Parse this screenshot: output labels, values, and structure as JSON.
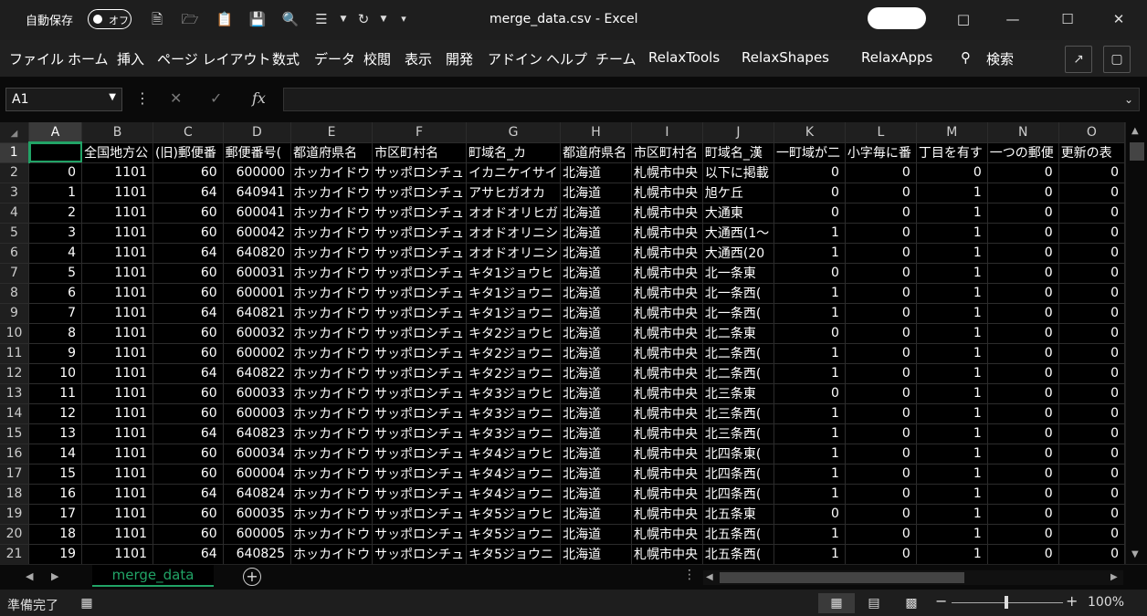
{
  "titlebar": {
    "autosave_label": "自動保存",
    "autosave_state": "オフ",
    "title": "merge_data.csv  -  Excel",
    "quick_access": [
      "new-doc",
      "open-folder",
      "clipboard",
      "save",
      "preview",
      "menu-lines",
      "redo",
      "customize"
    ]
  },
  "menu": [
    "ファイル",
    "ホーム",
    "挿入",
    "ページ レイアウト",
    "数式",
    "データ",
    "校閲",
    "表示",
    "開発",
    "アドイン",
    "ヘルプ",
    "チーム",
    "RelaxTools",
    "RelaxShapes",
    "RelaxApps",
    "検索"
  ],
  "formula": {
    "namebox": "A1",
    "fx": "fx",
    "content": ""
  },
  "columns": [
    "A",
    "B",
    "C",
    "D",
    "E",
    "F",
    "G",
    "H",
    "I",
    "J",
    "K",
    "L",
    "M",
    "N",
    "O"
  ],
  "header_row": [
    "",
    "全国地方公",
    "(旧)郵便番",
    "郵便番号(",
    "都道府県名",
    "市区町村名",
    "町域名_カ",
    "都道府県名",
    "市区町村名",
    "町域名_漢",
    "一町域が二",
    "小字毎に番",
    "丁目を有す",
    "一つの郵便",
    "更新の表"
  ],
  "rows": [
    [
      0,
      1101,
      60,
      600000,
      "ホッカイドウ",
      "サッポロシチュ",
      "イカニケイサイ",
      "北海道",
      "札幌市中央",
      "以下に掲載",
      0,
      0,
      0,
      0,
      0
    ],
    [
      1,
      1101,
      64,
      640941,
      "ホッカイドウ",
      "サッポロシチュ",
      "アサヒガオカ",
      "北海道",
      "札幌市中央",
      "旭ケ丘",
      0,
      0,
      1,
      0,
      0
    ],
    [
      2,
      1101,
      60,
      600041,
      "ホッカイドウ",
      "サッポロシチュ",
      "オオドオリヒガ",
      "北海道",
      "札幌市中央",
      "大通東",
      0,
      0,
      1,
      0,
      0
    ],
    [
      3,
      1101,
      60,
      600042,
      "ホッカイドウ",
      "サッポロシチュ",
      "オオドオリニシ",
      "北海道",
      "札幌市中央",
      "大通西(1〜",
      1,
      0,
      1,
      0,
      0
    ],
    [
      4,
      1101,
      64,
      640820,
      "ホッカイドウ",
      "サッポロシチュ",
      "オオドオリニシ",
      "北海道",
      "札幌市中央",
      "大通西(20",
      1,
      0,
      1,
      0,
      0
    ],
    [
      5,
      1101,
      60,
      600031,
      "ホッカイドウ",
      "サッポロシチュ",
      "キタ1ジョウヒ",
      "北海道",
      "札幌市中央",
      "北一条東",
      0,
      0,
      1,
      0,
      0
    ],
    [
      6,
      1101,
      60,
      600001,
      "ホッカイドウ",
      "サッポロシチュ",
      "キタ1ジョウニ",
      "北海道",
      "札幌市中央",
      "北一条西(",
      1,
      0,
      1,
      0,
      0
    ],
    [
      7,
      1101,
      64,
      640821,
      "ホッカイドウ",
      "サッポロシチュ",
      "キタ1ジョウニ",
      "北海道",
      "札幌市中央",
      "北一条西(",
      1,
      0,
      1,
      0,
      0
    ],
    [
      8,
      1101,
      60,
      600032,
      "ホッカイドウ",
      "サッポロシチュ",
      "キタ2ジョウヒ",
      "北海道",
      "札幌市中央",
      "北二条東",
      0,
      0,
      1,
      0,
      0
    ],
    [
      9,
      1101,
      60,
      600002,
      "ホッカイドウ",
      "サッポロシチュ",
      "キタ2ジョウニ",
      "北海道",
      "札幌市中央",
      "北二条西(",
      1,
      0,
      1,
      0,
      0
    ],
    [
      10,
      1101,
      64,
      640822,
      "ホッカイドウ",
      "サッポロシチュ",
      "キタ2ジョウニ",
      "北海道",
      "札幌市中央",
      "北二条西(",
      1,
      0,
      1,
      0,
      0
    ],
    [
      11,
      1101,
      60,
      600033,
      "ホッカイドウ",
      "サッポロシチュ",
      "キタ3ジョウヒ",
      "北海道",
      "札幌市中央",
      "北三条東",
      0,
      0,
      1,
      0,
      0
    ],
    [
      12,
      1101,
      60,
      600003,
      "ホッカイドウ",
      "サッポロシチュ",
      "キタ3ジョウニ",
      "北海道",
      "札幌市中央",
      "北三条西(",
      1,
      0,
      1,
      0,
      0
    ],
    [
      13,
      1101,
      64,
      640823,
      "ホッカイドウ",
      "サッポロシチュ",
      "キタ3ジョウニ",
      "北海道",
      "札幌市中央",
      "北三条西(",
      1,
      0,
      1,
      0,
      0
    ],
    [
      14,
      1101,
      60,
      600034,
      "ホッカイドウ",
      "サッポロシチュ",
      "キタ4ジョウヒ",
      "北海道",
      "札幌市中央",
      "北四条東(",
      1,
      0,
      1,
      0,
      0
    ],
    [
      15,
      1101,
      60,
      600004,
      "ホッカイドウ",
      "サッポロシチュ",
      "キタ4ジョウニ",
      "北海道",
      "札幌市中央",
      "北四条西(",
      1,
      0,
      1,
      0,
      0
    ],
    [
      16,
      1101,
      64,
      640824,
      "ホッカイドウ",
      "サッポロシチュ",
      "キタ4ジョウニ",
      "北海道",
      "札幌市中央",
      "北四条西(",
      1,
      0,
      1,
      0,
      0
    ],
    [
      17,
      1101,
      60,
      600035,
      "ホッカイドウ",
      "サッポロシチュ",
      "キタ5ジョウヒ",
      "北海道",
      "札幌市中央",
      "北五条東",
      0,
      0,
      1,
      0,
      0
    ],
    [
      18,
      1101,
      60,
      600005,
      "ホッカイドウ",
      "サッポロシチュ",
      "キタ5ジョウニ",
      "北海道",
      "札幌市中央",
      "北五条西(",
      1,
      0,
      1,
      0,
      0
    ],
    [
      19,
      1101,
      64,
      640825,
      "ホッカイドウ",
      "サッポロシチュ",
      "キタ5ジョウニ",
      "北海道",
      "札幌市中央",
      "北五条西(",
      1,
      0,
      1,
      0,
      0
    ]
  ],
  "sheet_tab": "merge_data",
  "status": {
    "text": "準備完了",
    "zoom": "100%"
  },
  "colors": {
    "accent": "#21a366",
    "background": "#000000"
  }
}
